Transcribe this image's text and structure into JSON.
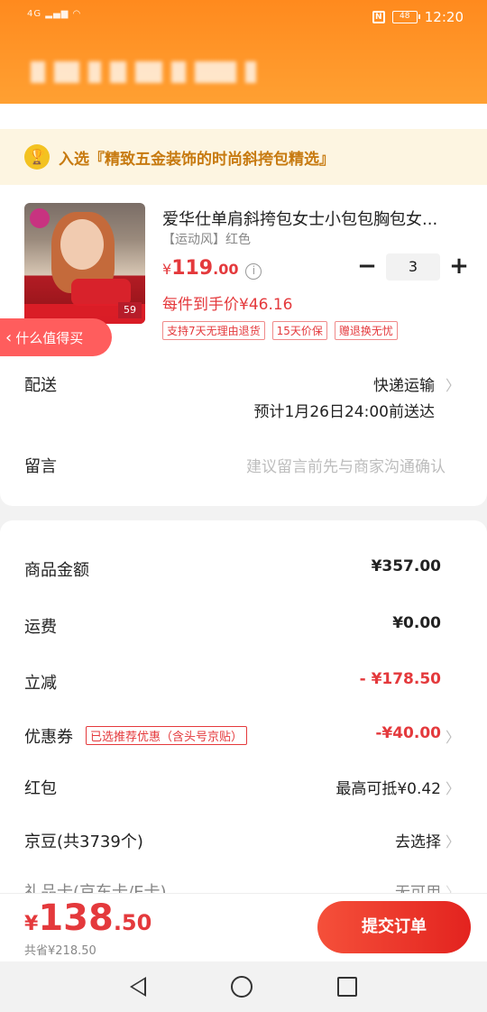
{
  "status_bar": {
    "signal": "4G",
    "battery": "48",
    "time": "12:20"
  },
  "banner": {
    "text": "入选『精致五金装饰的时尚斜挎包精选』"
  },
  "product": {
    "title": "爱华仕单肩斜挎包女士小包包胸包女...",
    "spec": "【运动风】红色",
    "price_symbol": "¥",
    "price_int": "119",
    "price_dec": ".00",
    "quantity": "3",
    "qty_minus": "−",
    "qty_plus": "+",
    "unit_price": "每件到手价¥46.16",
    "tags": [
      "支持7天无理由退货",
      "15天价保",
      "赠退换无忧"
    ],
    "image_price": "59"
  },
  "worth_bubble": {
    "label": "什么值得买"
  },
  "delivery": {
    "label": "配送",
    "method": "快递运输",
    "eta": "预计1月26日24:00前送达"
  },
  "message": {
    "label": "留言",
    "placeholder": "建议留言前先与商家沟通确认"
  },
  "summary": {
    "goods_label": "商品金额",
    "goods_value": "¥357.00",
    "shipping_label": "运费",
    "shipping_value": "¥0.00",
    "discount_label": "立减",
    "discount_value": "- ¥178.50",
    "coupon_label": "优惠券",
    "coupon_tag": "已选推荐优惠（含头号京贴）",
    "coupon_value": "-¥40.00",
    "redpacket_label": "红包",
    "redpacket_value": "最高可抵¥0.42",
    "jingdou_label": "京豆(共3739个)",
    "jingdou_value": "去选择",
    "giftcard_label": "礼品卡(京东卡/E卡)",
    "giftcard_value": "无可用"
  },
  "bottom": {
    "total_symbol": "¥",
    "total_int": "138",
    "total_dec": ".50",
    "saved": "共省¥218.50",
    "submit_label": "提交订单"
  },
  "colors": {
    "accent_red": "#e4393c",
    "header_orange": "#ff8a1e",
    "banner_gold": "#c77a10"
  }
}
